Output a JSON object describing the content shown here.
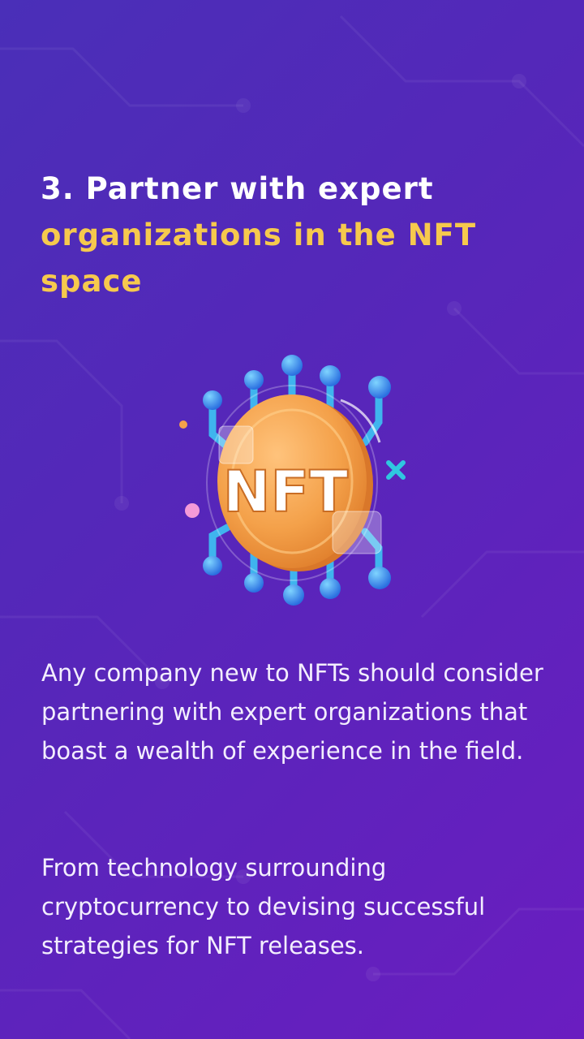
{
  "heading": {
    "line1": "3. Partner with expert",
    "line2": "organizations in the NFT",
    "line3": "space"
  },
  "illustration": {
    "coin_label": "NFT",
    "icon": "nft-coin-icon"
  },
  "paragraphs": [
    "Any company new to NFTs should consider partnering with expert organizations that boast a wealth of experience in the field.",
    "From technology surrounding cryptocurrency to devising successful strategies for NFT releases."
  ],
  "colors": {
    "background_start": "#4a2fb8",
    "background_end": "#6a1dc0",
    "heading_white": "#ffffff",
    "heading_accent": "#f6c94d",
    "coin": "#f4a14a",
    "circuit": "#3aa8e8"
  }
}
